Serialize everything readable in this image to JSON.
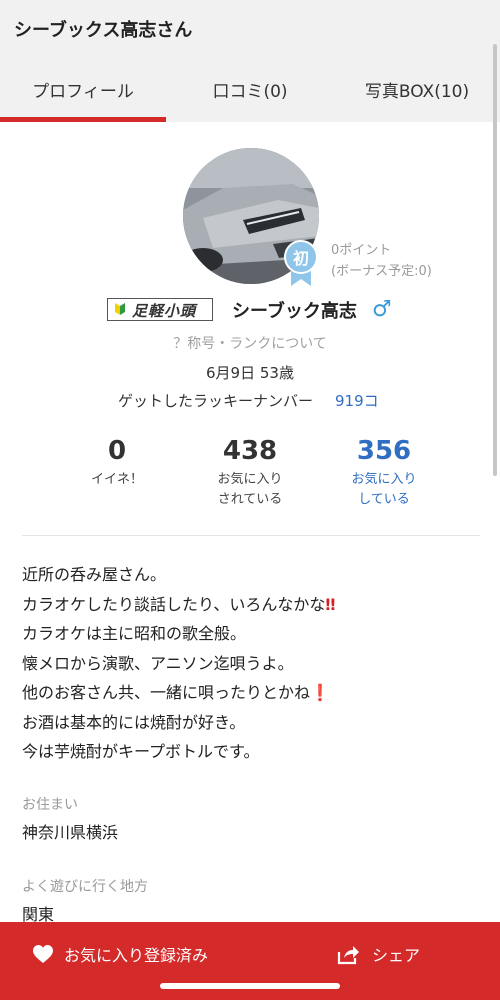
{
  "header": {
    "title": "シーブックス高志さん"
  },
  "tabs": [
    {
      "label": "プロフィール",
      "active": true
    },
    {
      "label": "口コミ(0)",
      "active": false
    },
    {
      "label": "写真BOX(10)",
      "active": false
    }
  ],
  "profile": {
    "rank_badge": "初",
    "points": "0ポイント",
    "bonus": "(ボーナス予定:0)",
    "title_badge": "足軽小頭",
    "nickname": "シーブック高志",
    "gender_symbol": "♂",
    "rank_link": "？称号・ランクについて",
    "birthday_age": "6月9日 53歳",
    "lucky_label": "ゲットしたラッキーナンバー",
    "lucky_value": "919コ"
  },
  "stats": [
    {
      "value": "0",
      "label_1": "イイネ！",
      "label_2": ""
    },
    {
      "value": "438",
      "label_1": "お気に入り",
      "label_2": "されている"
    },
    {
      "value": "356",
      "label_1": "お気に入り",
      "label_2": "している"
    }
  ],
  "bio": [
    {
      "text": "近所の呑み屋さん。",
      "mark": ""
    },
    {
      "text": "カラオケしたり談話したり、いろんなかな",
      "mark": "‼"
    },
    {
      "text": "カラオケは主に昭和の歌全般。",
      "mark": ""
    },
    {
      "text": "懐メロから演歌、アニソン迄唄うよ。",
      "mark": ""
    },
    {
      "text": "他のお客さん共、一緒に唄ったりとかね",
      "mark": "❗"
    },
    {
      "text": "お酒は基本的には焼酎が好き。",
      "mark": ""
    },
    {
      "text": "今は芋焼酎がキープボトルです。",
      "mark": ""
    }
  ],
  "details": {
    "residence_label": "お住まい",
    "residence_value": "神奈川県横浜",
    "area_label": "よく遊びに行く地方",
    "area_value": "関東"
  },
  "bottom": {
    "favorite_label": "お気に入り登録済み",
    "share_label": "シェア"
  },
  "colors": {
    "accent": "#d42a2a",
    "link": "#2f6ec0",
    "gender": "#3a9ad9",
    "rank_badge": "#8ec5e8"
  }
}
